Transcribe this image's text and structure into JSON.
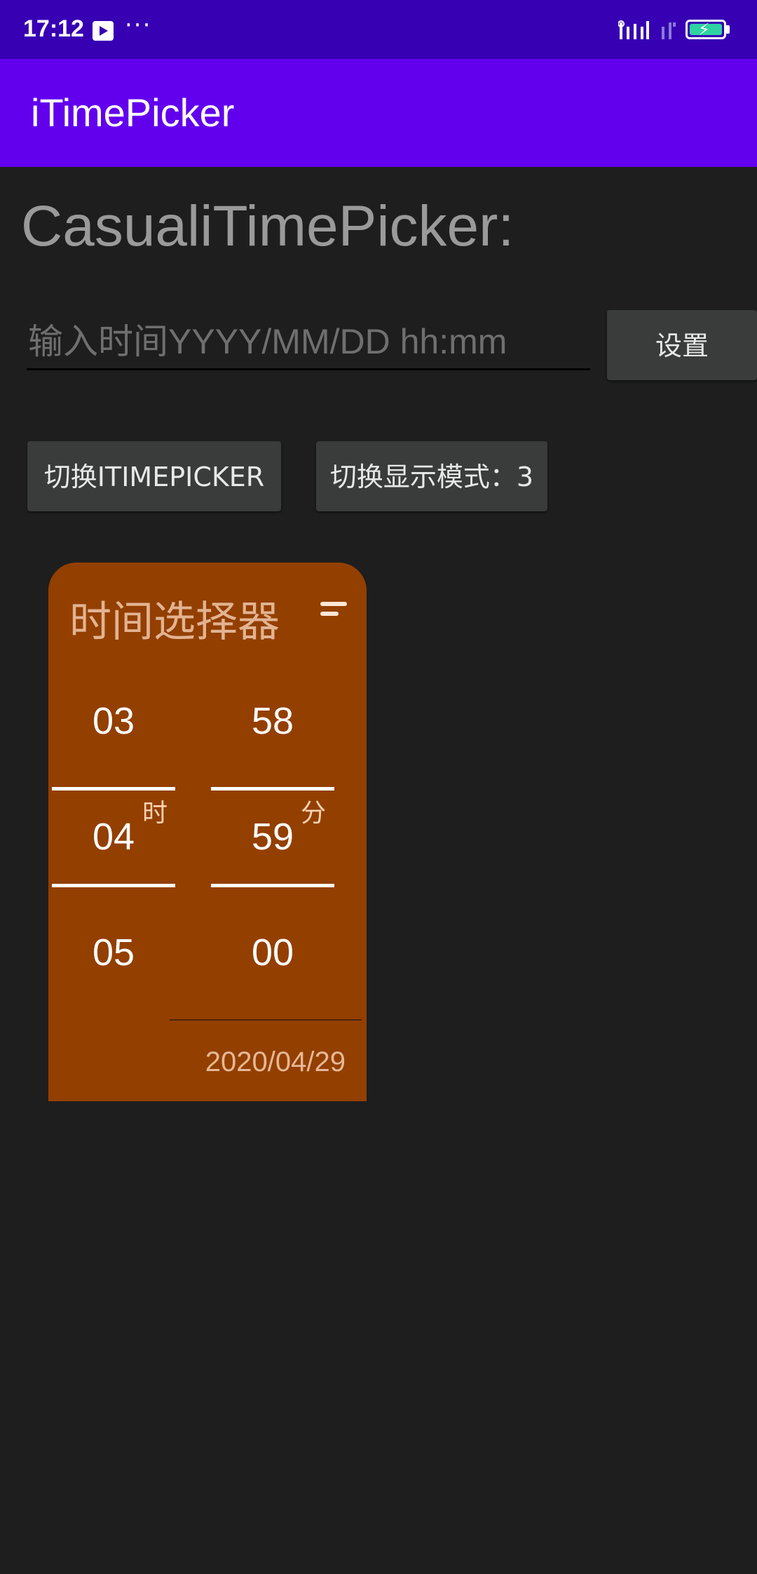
{
  "status_bar": {
    "time": "17:12",
    "dots": "···",
    "video_icon": "video-play-icon",
    "signal_icon": "signal-bars-icon",
    "battery_icon": "battery-charging-icon",
    "battery_color": "#2ed3a1"
  },
  "app_bar": {
    "title": "iTimePicker",
    "color": "#6200ee"
  },
  "main": {
    "heading": "CasualiTimePicker:",
    "time_input": {
      "value": "",
      "placeholder": "输入时间YYYY/MM/DD hh:mm"
    },
    "set_button": "设置",
    "switch_picker_button": "切换ITIMEPICKER",
    "switch_mode_button": "切换显示模式：3"
  },
  "picker": {
    "title": "时间选择器",
    "menu_icon": "sort-icon",
    "card_color": "#933f00",
    "hours": [
      "03",
      "04",
      "05"
    ],
    "minutes": [
      "58",
      "59",
      "00"
    ],
    "hour_unit": "时",
    "minute_unit": "分",
    "date": "2020/04/29"
  }
}
